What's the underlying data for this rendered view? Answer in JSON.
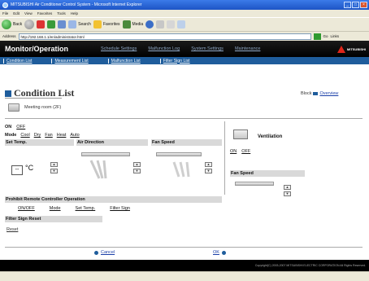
{
  "browser": {
    "window_title": "MITSUBISHI Air Conditioner Control System - Microsoft Internet Explorer",
    "menu": [
      "File",
      "Edit",
      "View",
      "Favorites",
      "Tools",
      "Help"
    ],
    "back_label": "Back",
    "search_label": "Search",
    "favorites_label": "Favorites",
    "media_label": "Media",
    "address_label": "Address",
    "address_value": "http://192.168.1.1/en/administrator.html",
    "go_label": "Go",
    "links_label": "Links"
  },
  "app": {
    "title": "Monitor/Operation",
    "nav": [
      "Schedule Settings",
      "Malfunction Log",
      "System Settings",
      "Maintenance"
    ],
    "logo_text": "MITSUBISHI",
    "subnav": [
      "Condition List",
      "Measurement List",
      "Malfunction List",
      "Filter Sign List"
    ]
  },
  "page": {
    "title": "Condition List",
    "block_label": "Block",
    "overview_link": "Overview",
    "unit_name": "Meeting room (2F)"
  },
  "controls": {
    "on_label": "ON",
    "off_label": "OFF",
    "mode_label": "Mode",
    "modes": [
      "Cool",
      "Dry",
      "Fan",
      "Heat",
      "Auto"
    ],
    "set_temp_label": "Set Temp.",
    "temp_value": "--",
    "temp_unit": "°C",
    "air_direction_label": "Air Direction",
    "fan_speed_label": "Fan Speed",
    "prohibit_label": "Prohibit Remote Controller Operation",
    "prohibit_items": [
      "ON/OFF",
      "Mode",
      "Set Temp.",
      "Filter Sign"
    ],
    "filter_sign_reset_label": "Filter Sign Reset",
    "reset_link": "Reset"
  },
  "ventilation": {
    "label": "Ventilation",
    "on_label": "ON",
    "off_label": "OFF",
    "fan_speed_label": "Fan Speed"
  },
  "footer": {
    "cancel_label": "Cancel",
    "ok_label": "OK",
    "copyright": "Copyright(C) 2003-2007 MITSUBISHI ELECTRIC CORPORATION All Rights Reserved."
  },
  "colors": {
    "header_bg": "#000000",
    "subnav_bg": "#1f5d9c",
    "section_header_bg": "#d9d9d9",
    "logo_red": "#e0261a"
  }
}
